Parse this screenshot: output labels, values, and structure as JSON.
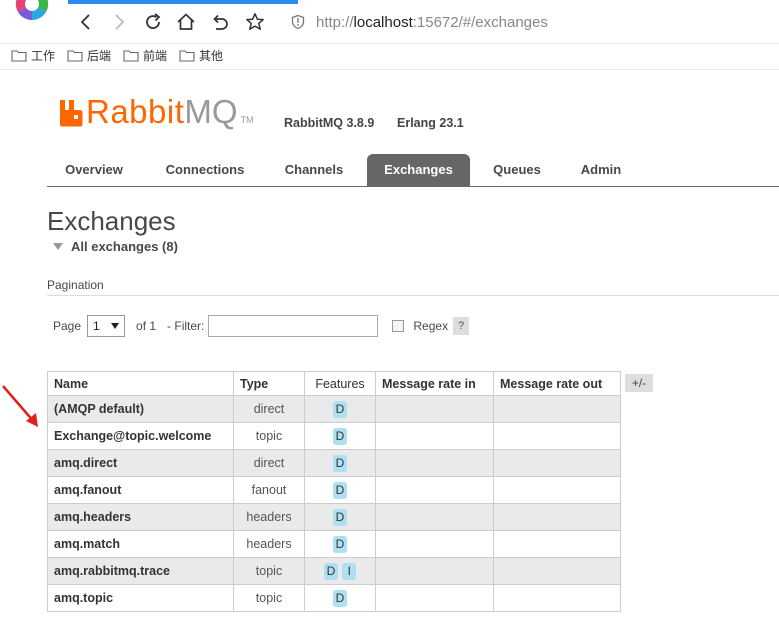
{
  "browser": {
    "url_prefix": "http://",
    "url_host": "localhost",
    "url_rest": ":15672/#/exchanges",
    "bookmarks": [
      "工作",
      "后端",
      "前端",
      "其他"
    ]
  },
  "header": {
    "logo_rabbit": "Rabbit",
    "logo_mq": "MQ",
    "logo_tm": "TM",
    "version": "RabbitMQ 3.8.9",
    "erlang": "Erlang 23.1"
  },
  "tabs": [
    "Overview",
    "Connections",
    "Channels",
    "Exchanges",
    "Queues",
    "Admin"
  ],
  "active_tab": "Exchanges",
  "page": {
    "title": "Exchanges",
    "section_title": "All exchanges (8)",
    "pagination_label": "Pagination",
    "page_label": "Page",
    "page_value": "1",
    "of_label": "of 1",
    "filter_label": "- Filter:",
    "filter_value": "",
    "regex_label": "Regex",
    "help_label": "?",
    "column_toggle": "+/-"
  },
  "table": {
    "columns": [
      "Name",
      "Type",
      "Features",
      "Message rate in",
      "Message rate out"
    ],
    "rows": [
      {
        "name": "(AMQP default)",
        "type": "direct",
        "features": [
          "D"
        ],
        "rate_in": "",
        "rate_out": ""
      },
      {
        "name": "Exchange@topic.welcome",
        "type": "topic",
        "features": [
          "D"
        ],
        "rate_in": "",
        "rate_out": ""
      },
      {
        "name": "amq.direct",
        "type": "direct",
        "features": [
          "D"
        ],
        "rate_in": "",
        "rate_out": ""
      },
      {
        "name": "amq.fanout",
        "type": "fanout",
        "features": [
          "D"
        ],
        "rate_in": "",
        "rate_out": ""
      },
      {
        "name": "amq.headers",
        "type": "headers",
        "features": [
          "D"
        ],
        "rate_in": "",
        "rate_out": ""
      },
      {
        "name": "amq.match",
        "type": "headers",
        "features": [
          "D"
        ],
        "rate_in": "",
        "rate_out": ""
      },
      {
        "name": "amq.rabbitmq.trace",
        "type": "topic",
        "features": [
          "D",
          "I"
        ],
        "rate_in": "",
        "rate_out": ""
      },
      {
        "name": "amq.topic",
        "type": "topic",
        "features": [
          "D"
        ],
        "rate_in": "",
        "rate_out": ""
      }
    ]
  },
  "colors": {
    "brand_orange": "#ff6600",
    "tab_active": "#666666",
    "badge": "#aee0f2",
    "annotation_arrow": "#e02020"
  }
}
